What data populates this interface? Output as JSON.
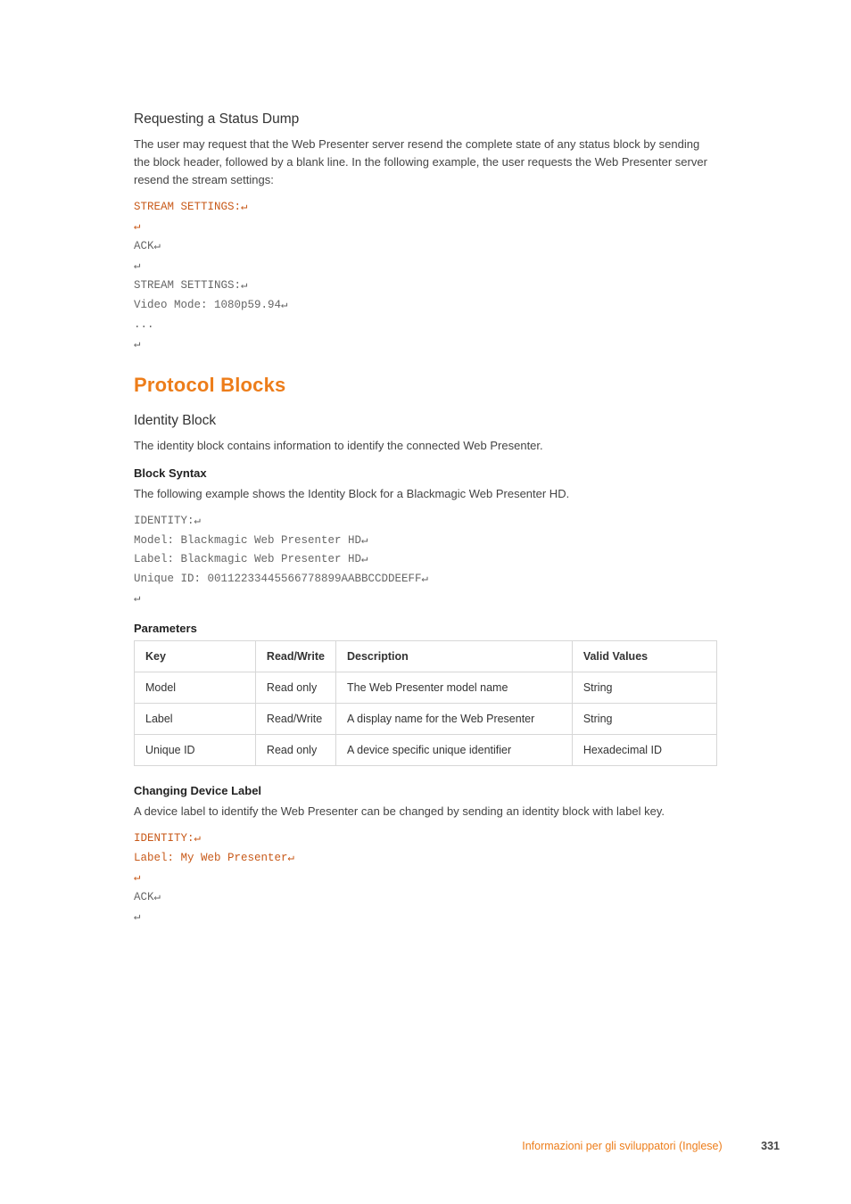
{
  "section1": {
    "title": "Requesting a Status Dump",
    "body": "The user may request that the Web Presenter server resend the complete state of any status block by sending the block header, followed by a blank line. In the following example, the user requests the Web Presenter server resend the stream settings:",
    "code_sent_1": "STREAM SETTINGS:↵",
    "code_sent_2": "↵",
    "code_recv_1": "ACK↵",
    "code_recv_2": "↵",
    "code_recv_3": "STREAM SETTINGS:↵",
    "code_recv_4": "Video Mode: 1080p59.94↵",
    "code_recv_5": "...",
    "code_recv_6": "↵"
  },
  "h1": "Protocol Blocks",
  "identity": {
    "title": "Identity Block",
    "body": "The identity block contains information to identify the connected Web Presenter.",
    "syntax_title": "Block Syntax",
    "syntax_body": "The following example shows the Identity Block for a Blackmagic Web Presenter HD.",
    "code_1": "IDENTITY:↵",
    "code_2": "Model: Blackmagic Web Presenter HD↵",
    "code_3": "Label: Blackmagic Web Presenter HD↵",
    "code_4": "Unique ID: 00112233445566778899AABBCCDDEEFF↵",
    "code_5": "↵",
    "params_title": "Parameters",
    "table": {
      "headers": {
        "key": "Key",
        "rw": "Read/Write",
        "desc": "Description",
        "valid": "Valid Values"
      },
      "rows": [
        {
          "key": "Model",
          "rw": "Read only",
          "desc": "The Web Presenter model name",
          "valid": "String"
        },
        {
          "key": "Label",
          "rw": "Read/Write",
          "desc": "A display name for the Web Presenter",
          "valid": "String"
        },
        {
          "key": "Unique ID",
          "rw": "Read only",
          "desc": "A device specific unique identifier",
          "valid": "Hexadecimal ID"
        }
      ]
    },
    "change_title": "Changing Device Label",
    "change_body": "A device label to identify the Web Presenter can be changed by sending an identity block with label key.",
    "change_code_sent_1": "IDENTITY:↵",
    "change_code_sent_2": "Label: My Web Presenter↵",
    "change_code_sent_3": "↵",
    "change_code_recv_1": "ACK↵",
    "change_code_recv_2": "↵"
  },
  "footer": {
    "label": "Informazioni per gli sviluppatori (Inglese)",
    "page": "331"
  }
}
